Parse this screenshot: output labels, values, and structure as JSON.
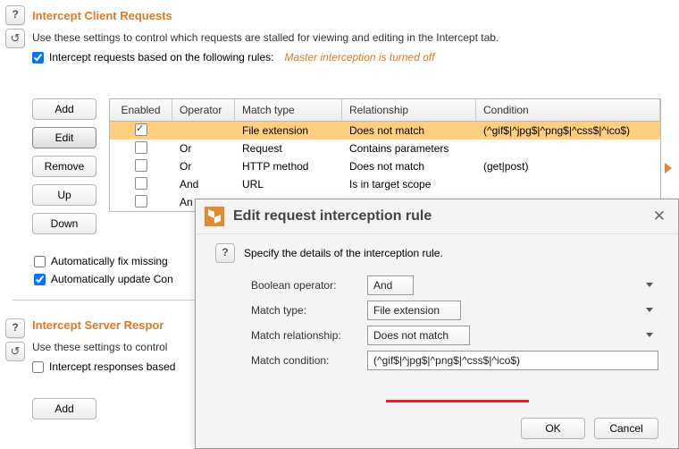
{
  "section1": {
    "title": "Intercept Client Requests",
    "desc": "Use these settings to control which requests are stalled for viewing and editing in the Intercept tab.",
    "chk_label": "Intercept requests based on the following rules:",
    "warn": "Master interception is turned off"
  },
  "buttons": {
    "add": "Add",
    "edit": "Edit",
    "remove": "Remove",
    "up": "Up",
    "down": "Down"
  },
  "headers": {
    "en": "Enabled",
    "op": "Operator",
    "mt": "Match type",
    "re": "Relationship",
    "co": "Condition"
  },
  "rows": [
    {
      "en": true,
      "op": "",
      "mt": "File extension",
      "re": "Does not match",
      "co": "(^gif$|^jpg$|^png$|^css$|^ico$)"
    },
    {
      "en": false,
      "op": "Or",
      "mt": "Request",
      "re": "Contains parameters",
      "co": ""
    },
    {
      "en": false,
      "op": "Or",
      "mt": "HTTP method",
      "re": "Does not match",
      "co": "(get|post)"
    },
    {
      "en": false,
      "op": "And",
      "mt": "URL",
      "re": "Is in target scope",
      "co": ""
    },
    {
      "en": false,
      "op": "An",
      "mt": "",
      "re": "",
      "co": ""
    }
  ],
  "auto1": "Automatically fix missing",
  "auto2": "Automatically update Con",
  "section2": {
    "title": "Intercept Server Respor",
    "desc": "Use these settings to control",
    "chk_label": "Intercept responses based"
  },
  "dialog": {
    "title": "Edit request interception rule",
    "desc": "Specify the details of the interception rule.",
    "labels": {
      "bo": "Boolean operator:",
      "mt": "Match type:",
      "mr": "Match relationship:",
      "mc": "Match condition:"
    },
    "values": {
      "bo": "And",
      "mt": "File extension",
      "mr": "Does not match",
      "mc": "(^gif$|^jpg$|^png$|^css$|^ico$)"
    },
    "ok": "OK",
    "cancel": "Cancel"
  }
}
